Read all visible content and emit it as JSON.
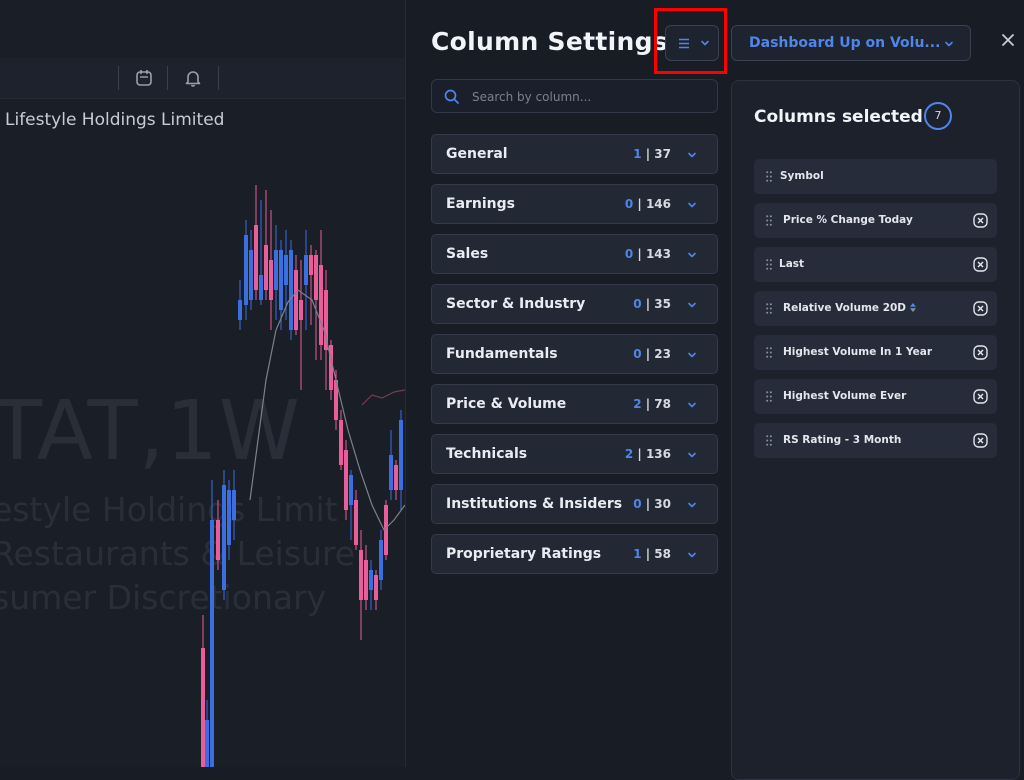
{
  "chart": {
    "company": "Lifestyle Holdings Limited",
    "watermark_ticker": "TAT,1W",
    "watermark_line1": "estyle Holdings Limit",
    "watermark_line2": "Restaurants & Leisure",
    "watermark_line3": "sumer Discretionary",
    "toolbar_icons": [
      "calendar-icon",
      "bell-icon"
    ],
    "colors": {
      "up": "#3b6fe0",
      "down": "#e85d9a",
      "ma": "#7d818c",
      "ma2": "#7a3a52"
    }
  },
  "panel": {
    "title": "Column Settings",
    "view_button_icon": "list-icon",
    "preset": "Dashboard Up on Volu...",
    "close_icon": "close-icon",
    "search_placeholder": "Search by column...",
    "categories": [
      {
        "name": "General",
        "selected": "1",
        "total": "37"
      },
      {
        "name": "Earnings",
        "selected": "0",
        "total": "146"
      },
      {
        "name": "Sales",
        "selected": "0",
        "total": "143"
      },
      {
        "name": "Sector & Industry",
        "selected": "0",
        "total": "35"
      },
      {
        "name": "Fundamentals",
        "selected": "0",
        "total": "23"
      },
      {
        "name": "Price & Volume",
        "selected": "2",
        "total": "78"
      },
      {
        "name": "Technicals",
        "selected": "2",
        "total": "136"
      },
      {
        "name": "Institutions & Insiders",
        "selected": "0",
        "total": "30"
      },
      {
        "name": "Proprietary Ratings",
        "selected": "1",
        "total": "58"
      }
    ],
    "selected_title": "Columns selected",
    "selected_count": "7",
    "selected_columns": [
      {
        "label": "Symbol",
        "removable": false
      },
      {
        "label": "Price % Change Today",
        "removable": true
      },
      {
        "label": "Last",
        "removable": true
      },
      {
        "label": "Relative Volume 20D",
        "removable": true,
        "sort_icon": true
      },
      {
        "label": "Highest Volume In 1 Year",
        "removable": true
      },
      {
        "label": "Highest Volume Ever",
        "removable": true
      },
      {
        "label": "RS Rating - 3 Month",
        "removable": true
      }
    ],
    "accent_color": "#4f86e8",
    "highlight_color": "#ff0000"
  }
}
